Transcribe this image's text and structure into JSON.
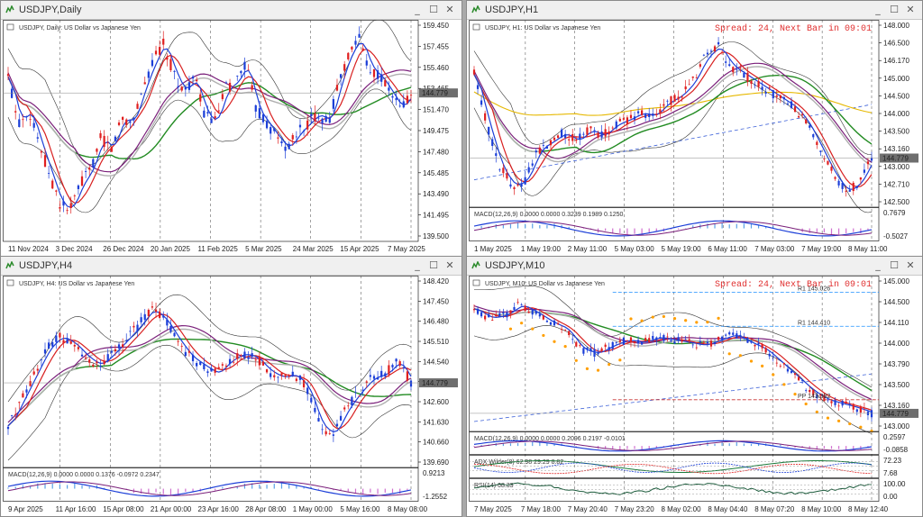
{
  "windows": [
    {
      "id": "daily",
      "title": "USDJPY,Daily",
      "header": "USDJPY, Daily:  US Dollar vs Japanese Yen",
      "price_labels": [
        "159.450",
        "157.455",
        "155.460",
        "153.465",
        "151.470",
        "149.475",
        "147.480",
        "145.485",
        "143.490",
        "141.495",
        "139.500"
      ],
      "current_price": "144.779",
      "time_labels": [
        "11 Nov 2024",
        "3 Dec 2024",
        "26 Dec 2024",
        "20 Jan 2025",
        "11 Feb 2025",
        "5 Mar 2025",
        "24 Mar 2025",
        "15 Apr 2025",
        "7 May 2025"
      ],
      "spread": "",
      "indicator_panes": []
    },
    {
      "id": "h1",
      "title": "USDJPY,H1",
      "header": "USDJPY, H1:  US Dollar vs Japanese Yen",
      "price_labels": [
        "148.000",
        "146.500",
        "146.170",
        "145.000",
        "144.500",
        "144.000",
        "143.500",
        "143.160",
        "143.000",
        "142.710",
        "142.500"
      ],
      "current_price": "144.779",
      "time_labels": [
        "1 May 2025",
        "1 May 19:00",
        "2 May 11:00",
        "5 May 03:00",
        "5 May 19:00",
        "6 May 11:00",
        "7 May 03:00",
        "7 May 19:00",
        "8 May 11:00"
      ],
      "spread": "Spread: 24, Next Bar in 09:01",
      "indicator_panes": [
        {
          "label": "MACD(12,26,9) 0.0000 0.0000 0.3239 0.1989 0.1250",
          "scale_top": "0.7679",
          "scale_bottom": "-0.5027"
        }
      ]
    },
    {
      "id": "h4",
      "title": "USDJPY,H4",
      "header": "USDJPY, H4:  US Dollar vs Japanese Yen",
      "price_labels": [
        "148.420",
        "147.450",
        "146.480",
        "145.510",
        "144.540",
        "143.570",
        "142.600",
        "141.630",
        "140.660",
        "139.690"
      ],
      "current_price": "144.779",
      "time_labels": [
        "9 Apr 2025",
        "11 Apr 16:00",
        "15 Apr 08:00",
        "21 Apr 00:00",
        "23 Apr 16:00",
        "28 Apr 08:00",
        "1 May 00:00",
        "5 May 16:00",
        "8 May 08:00"
      ],
      "spread": "",
      "indicator_panes": [
        {
          "label": "MACD(12,26,9) 0.0000 0.0000 0.1376 -0.0972 0.2347",
          "scale_top": "0.9213",
          "scale_bottom": "-1.2552"
        }
      ]
    },
    {
      "id": "m10",
      "title": "USDJPY,M10",
      "header": "USDJPY, M10:  US Dollar vs Japanese Yen",
      "price_labels": [
        "145.000",
        "144.500",
        "144.110",
        "144.000",
        "143.790",
        "143.500",
        "143.160",
        "143.000"
      ],
      "current_price": "144.779",
      "time_labels": [
        "7 May 2025",
        "7 May 18:00",
        "7 May 20:40",
        "7 May 23:20",
        "8 May 02:00",
        "8 May 04:40",
        "8 May 07:20",
        "8 May 10:00",
        "8 May 12:40"
      ],
      "spread": "Spread: 24, Next Bar in 09:01",
      "pivots": [
        {
          "label": "R1 145.026",
          "color": "#1e90ff"
        },
        {
          "label": "R1 144.410",
          "color": "#1e90ff"
        },
        {
          "label": "PP 143.382",
          "color": "#c83232"
        }
      ],
      "indicator_panes": [
        {
          "label": "MACD(12,26,9) 0.0000 0.0000 0.2096 0.2197 -0.0101",
          "scale_top": "0.2597",
          "scale_bottom": "-0.0858"
        },
        {
          "label": "ADX Wilder(8) 62.98 29.29 8.82",
          "scale_top": "72.23",
          "scale_bottom": "7.68",
          "levels": [
            "45.00",
            "25.00",
            "20.00"
          ]
        },
        {
          "label": "RSI(14) 68.33",
          "scale_top": "100.00",
          "scale_bottom": "0.00",
          "levels": [
            "70.00",
            "50.00",
            "30.00"
          ]
        }
      ]
    }
  ],
  "colors": {
    "bull": "#1c3fd8",
    "bear": "#e02020",
    "ma_blue": "#1c3fd8",
    "ma_red": "#d82020",
    "ma_purple": "#7a1f7a",
    "ma_green": "#228b22",
    "ma_grey": "#b0b0b0",
    "bb": "#333333",
    "ma_yellow": "#e6b800",
    "dash_blue": "#3a5fd8",
    "psar": "#ff9f00"
  }
}
